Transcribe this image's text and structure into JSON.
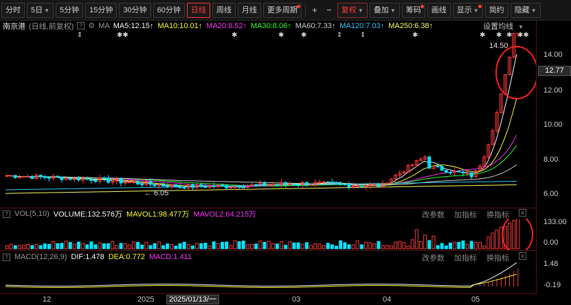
{
  "toolbar": {
    "periods": [
      "分时",
      "5日",
      "5分钟",
      "15分钟",
      "30分钟",
      "60分钟",
      "日线",
      "周线",
      "月线",
      "更多周期"
    ],
    "active_period": "日线",
    "plus": "+",
    "minus": "−",
    "fuquan": "复权",
    "overlay": "叠加",
    "chips": "筹码",
    "draw": "画线",
    "display": "显示",
    "simple": "简约",
    "hide": "隐藏"
  },
  "main": {
    "stock": "南京港",
    "mode": "(日线,前复权)",
    "ma_label": "MA",
    "ma": [
      {
        "label": "MA5:12.15",
        "color": "#ffffff"
      },
      {
        "label": "MA10:10.01",
        "color": "#ffff33"
      },
      {
        "label": "MA20:8.52",
        "color": "#ff33ff"
      },
      {
        "label": "MA30:8.06",
        "color": "#33ff33"
      },
      {
        "label": "MA60:7.33",
        "color": "#cfcfcf"
      },
      {
        "label": "MA120:7.03",
        "color": "#33c8ff"
      },
      {
        "label": "MA250:6.38",
        "color": "#ffff66"
      }
    ],
    "settings": "设置均线",
    "high_label": "14.50",
    "low_label": "6.05",
    "current_price": "12.77",
    "y_ticks": [
      "14.00",
      "12.00",
      "10.00",
      "8.00",
      "6.00"
    ]
  },
  "volume": {
    "name": "VOL(5,10)",
    "volume": "VOLUME:132.576万",
    "mavol1": "MAVOL1:98.477万",
    "mavol2": "MAVOL2:64.215万",
    "y_ticks": [
      "133.00",
      "0.00"
    ],
    "tools": [
      "改参数",
      "加指标",
      "换指标"
    ]
  },
  "macd": {
    "name": "MACD(12,26,9)",
    "dif": "DIF:1.478",
    "dea": "DEA:0.772",
    "macd": "MACD:1.411",
    "y_ticks": [
      "1.48",
      "-0.19"
    ],
    "tools": [
      "改参数",
      "加指标",
      "换指标"
    ]
  },
  "x_axis": {
    "labels": [
      "12",
      "2025",
      "03",
      "04",
      "05"
    ],
    "cursor": "2025/01/13/一"
  },
  "colors": {
    "up": "#ff3b3b",
    "down": "#00e5ff",
    "annotation": "#ff2020"
  },
  "icons": {
    "arrow": "↑",
    "plus": "+",
    "minus": "−",
    "close": "x",
    "help": "?",
    "gear": "⚙"
  }
}
